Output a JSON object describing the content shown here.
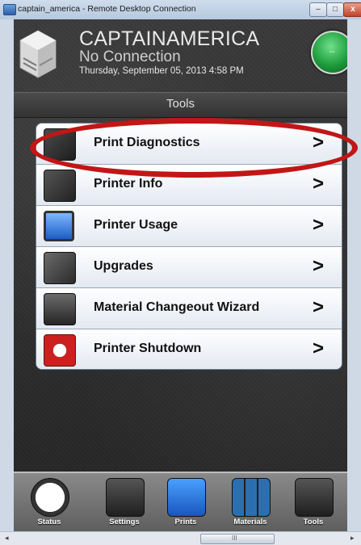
{
  "window": {
    "title": "captain_america - Remote Desktop Connection",
    "min_label": "–",
    "max_label": "□",
    "close_label": "x"
  },
  "header": {
    "printer_name": "CAPTAINAMERICA",
    "connection_status": "No Connection",
    "datetime": "Thursday, September 05, 2013 4:58 PM",
    "status_light_label": "--",
    "status_color": "#1e9c3c"
  },
  "section": {
    "title": "Tools"
  },
  "menu": {
    "items": [
      {
        "label": "Print Diagnostics",
        "icon": "diagnostics-icon",
        "chevron": ">"
      },
      {
        "label": "Printer Info",
        "icon": "printer-info-icon",
        "chevron": ">"
      },
      {
        "label": "Printer Usage",
        "icon": "monitor-icon",
        "chevron": ">"
      },
      {
        "label": "Upgrades",
        "icon": "wrench-icon",
        "chevron": ">"
      },
      {
        "label": "Material Changeout Wizard",
        "icon": "material-cartridge-icon",
        "chevron": ">"
      },
      {
        "label": "Printer Shutdown",
        "icon": "power-icon",
        "chevron": ">"
      }
    ]
  },
  "toolbar": {
    "buttons": [
      {
        "label": "Status",
        "icon": "clock-icon"
      },
      {
        "label": "Settings",
        "icon": "sliders-icon"
      },
      {
        "label": "Prints",
        "icon": "document-icon"
      },
      {
        "label": "Materials",
        "icon": "cartridges-icon"
      },
      {
        "label": "Tools",
        "icon": "tools-icon"
      }
    ]
  },
  "scrollbar": {
    "grip": "III",
    "left_arrow": "◂",
    "right_arrow": "▸"
  },
  "annotation": {
    "color": "#c21616"
  }
}
